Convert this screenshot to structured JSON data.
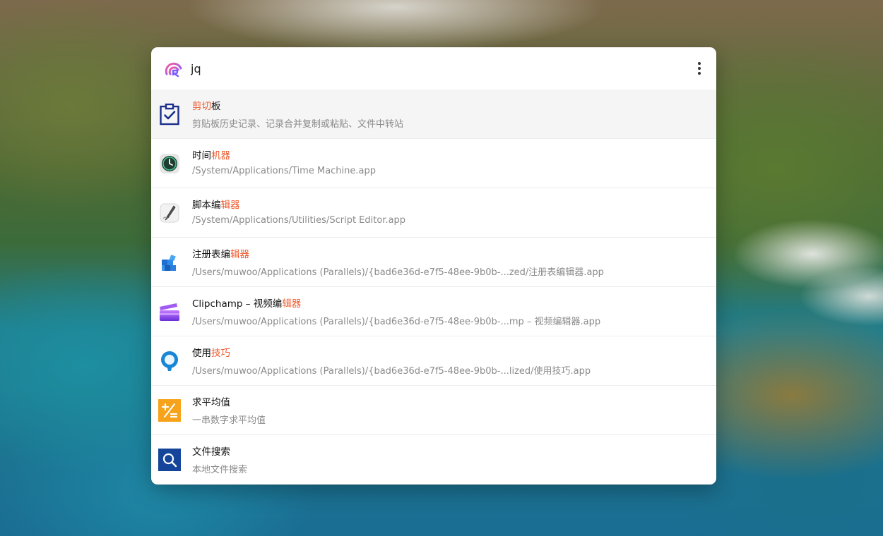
{
  "search": {
    "value": "jq",
    "logo_icon": "rubick-logo-icon",
    "more_icon": "more-vertical-icon"
  },
  "colors": {
    "highlight": "#ee5a2c",
    "selected_row": "#f5f5f5"
  },
  "results": [
    {
      "icon": "clipboard-check-icon",
      "title_hl": "剪切",
      "title_rest": "板",
      "subtitle": "剪贴板历史记录、记录合并复制或粘贴、文件中转站"
    },
    {
      "icon": "time-machine-icon",
      "title_pre": "时间",
      "title_hl": "机器",
      "subtitle": "/System/Applications/Time Machine.app"
    },
    {
      "icon": "script-editor-icon",
      "title_pre": "脚本编",
      "title_hl": "辑器",
      "subtitle": "/System/Applications/Utilities/Script Editor.app"
    },
    {
      "icon": "registry-editor-icon",
      "title_pre": "注册表编",
      "title_hl": "辑器",
      "subtitle": "/Users/muwoo/Applications (Parallels)/{bad6e36d-e7f5-48ee-9b0b-...zed/注册表编辑器.app"
    },
    {
      "icon": "clipchamp-icon",
      "title_pre": "Clipchamp – 视频编",
      "title_hl": "辑器",
      "subtitle": "/Users/muwoo/Applications (Parallels)/{bad6e36d-e7f5-48ee-9b0b-...mp – 视频编辑器.app"
    },
    {
      "icon": "tips-lightbulb-icon",
      "title_pre": "使用",
      "title_hl": "技巧",
      "subtitle": "/Users/muwoo/Applications (Parallels)/{bad6e36d-e7f5-48ee-9b0b-...lized/使用技巧.app"
    },
    {
      "icon": "average-calculator-icon",
      "title_pre": "求平均值",
      "subtitle": "一串数字求平均值"
    },
    {
      "icon": "file-search-icon",
      "title_pre": "文件搜索",
      "subtitle": "本地文件搜索"
    }
  ]
}
